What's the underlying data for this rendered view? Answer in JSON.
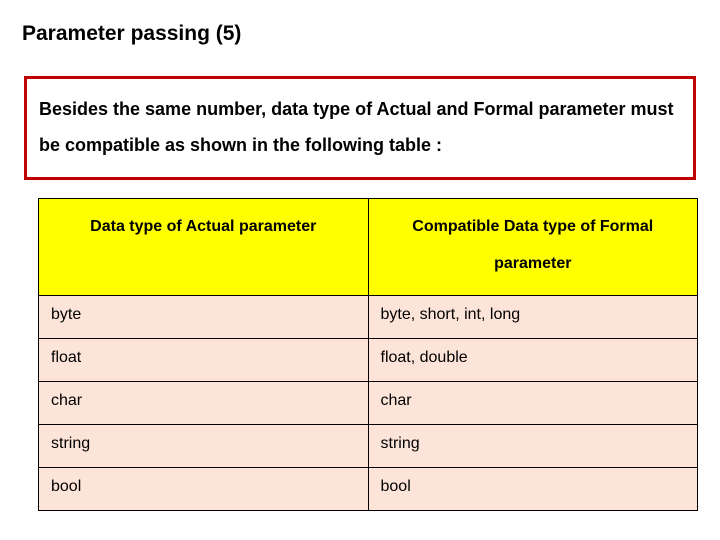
{
  "title": "Parameter passing (5)",
  "callout": "Besides the same number, data type of Actual and Formal parameter must be compatible as shown in the following table :",
  "table": {
    "headers": {
      "actual": "Data type of Actual parameter",
      "formal": "Compatible Data type of Formal parameter"
    },
    "rows": [
      {
        "actual": "byte",
        "formal": "byte, short,  int,   long"
      },
      {
        "actual": "float",
        "formal": "float, double"
      },
      {
        "actual": "char",
        "formal": "char"
      },
      {
        "actual": "string",
        "formal": "string"
      },
      {
        "actual": "bool",
        "formal": "bool"
      }
    ]
  },
  "chart_data": {
    "type": "table",
    "title": "Compatible data types for actual vs formal parameters",
    "columns": [
      "Data type of Actual parameter",
      "Compatible Data type of Formal parameter"
    ],
    "rows": [
      [
        "byte",
        "byte, short, int, long"
      ],
      [
        "float",
        "float, double"
      ],
      [
        "char",
        "char"
      ],
      [
        "string",
        "string"
      ],
      [
        "bool",
        "bool"
      ]
    ]
  }
}
